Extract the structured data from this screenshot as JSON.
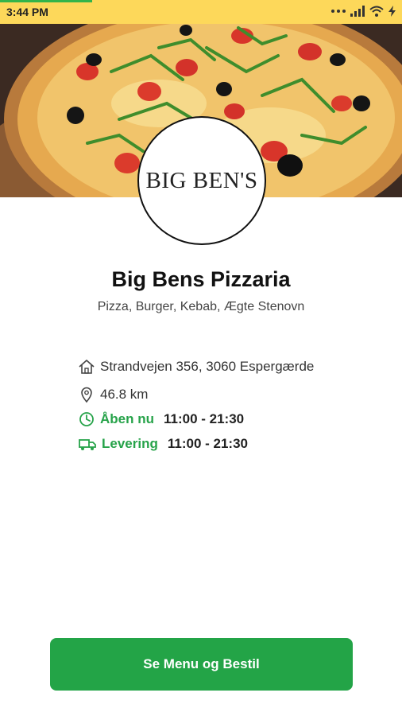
{
  "status_bar": {
    "time": "3:44 PM",
    "icons": [
      "dots-icon",
      "signal-icon",
      "wifi-icon",
      "charging-icon"
    ],
    "background": "#fdd85a"
  },
  "header": {
    "hero_image": "pizza-photo",
    "logo_text": "BIG BEN'S"
  },
  "restaurant": {
    "name": "Big Bens Pizzaria",
    "categories": "Pizza, Burger, Kebab, Ægte Stenovn"
  },
  "info": {
    "address": "Strandvejen 356, 3060 Espergærde",
    "distance": "46.8 km",
    "open_label": "Åben nu",
    "open_hours": "11:00 - 21:30",
    "delivery_label": "Levering",
    "delivery_hours": "11:00 - 21:30"
  },
  "cta": {
    "label": "Se Menu og Bestil"
  },
  "colors": {
    "accent_green": "#23a447",
    "status_yellow": "#fdd85a"
  }
}
